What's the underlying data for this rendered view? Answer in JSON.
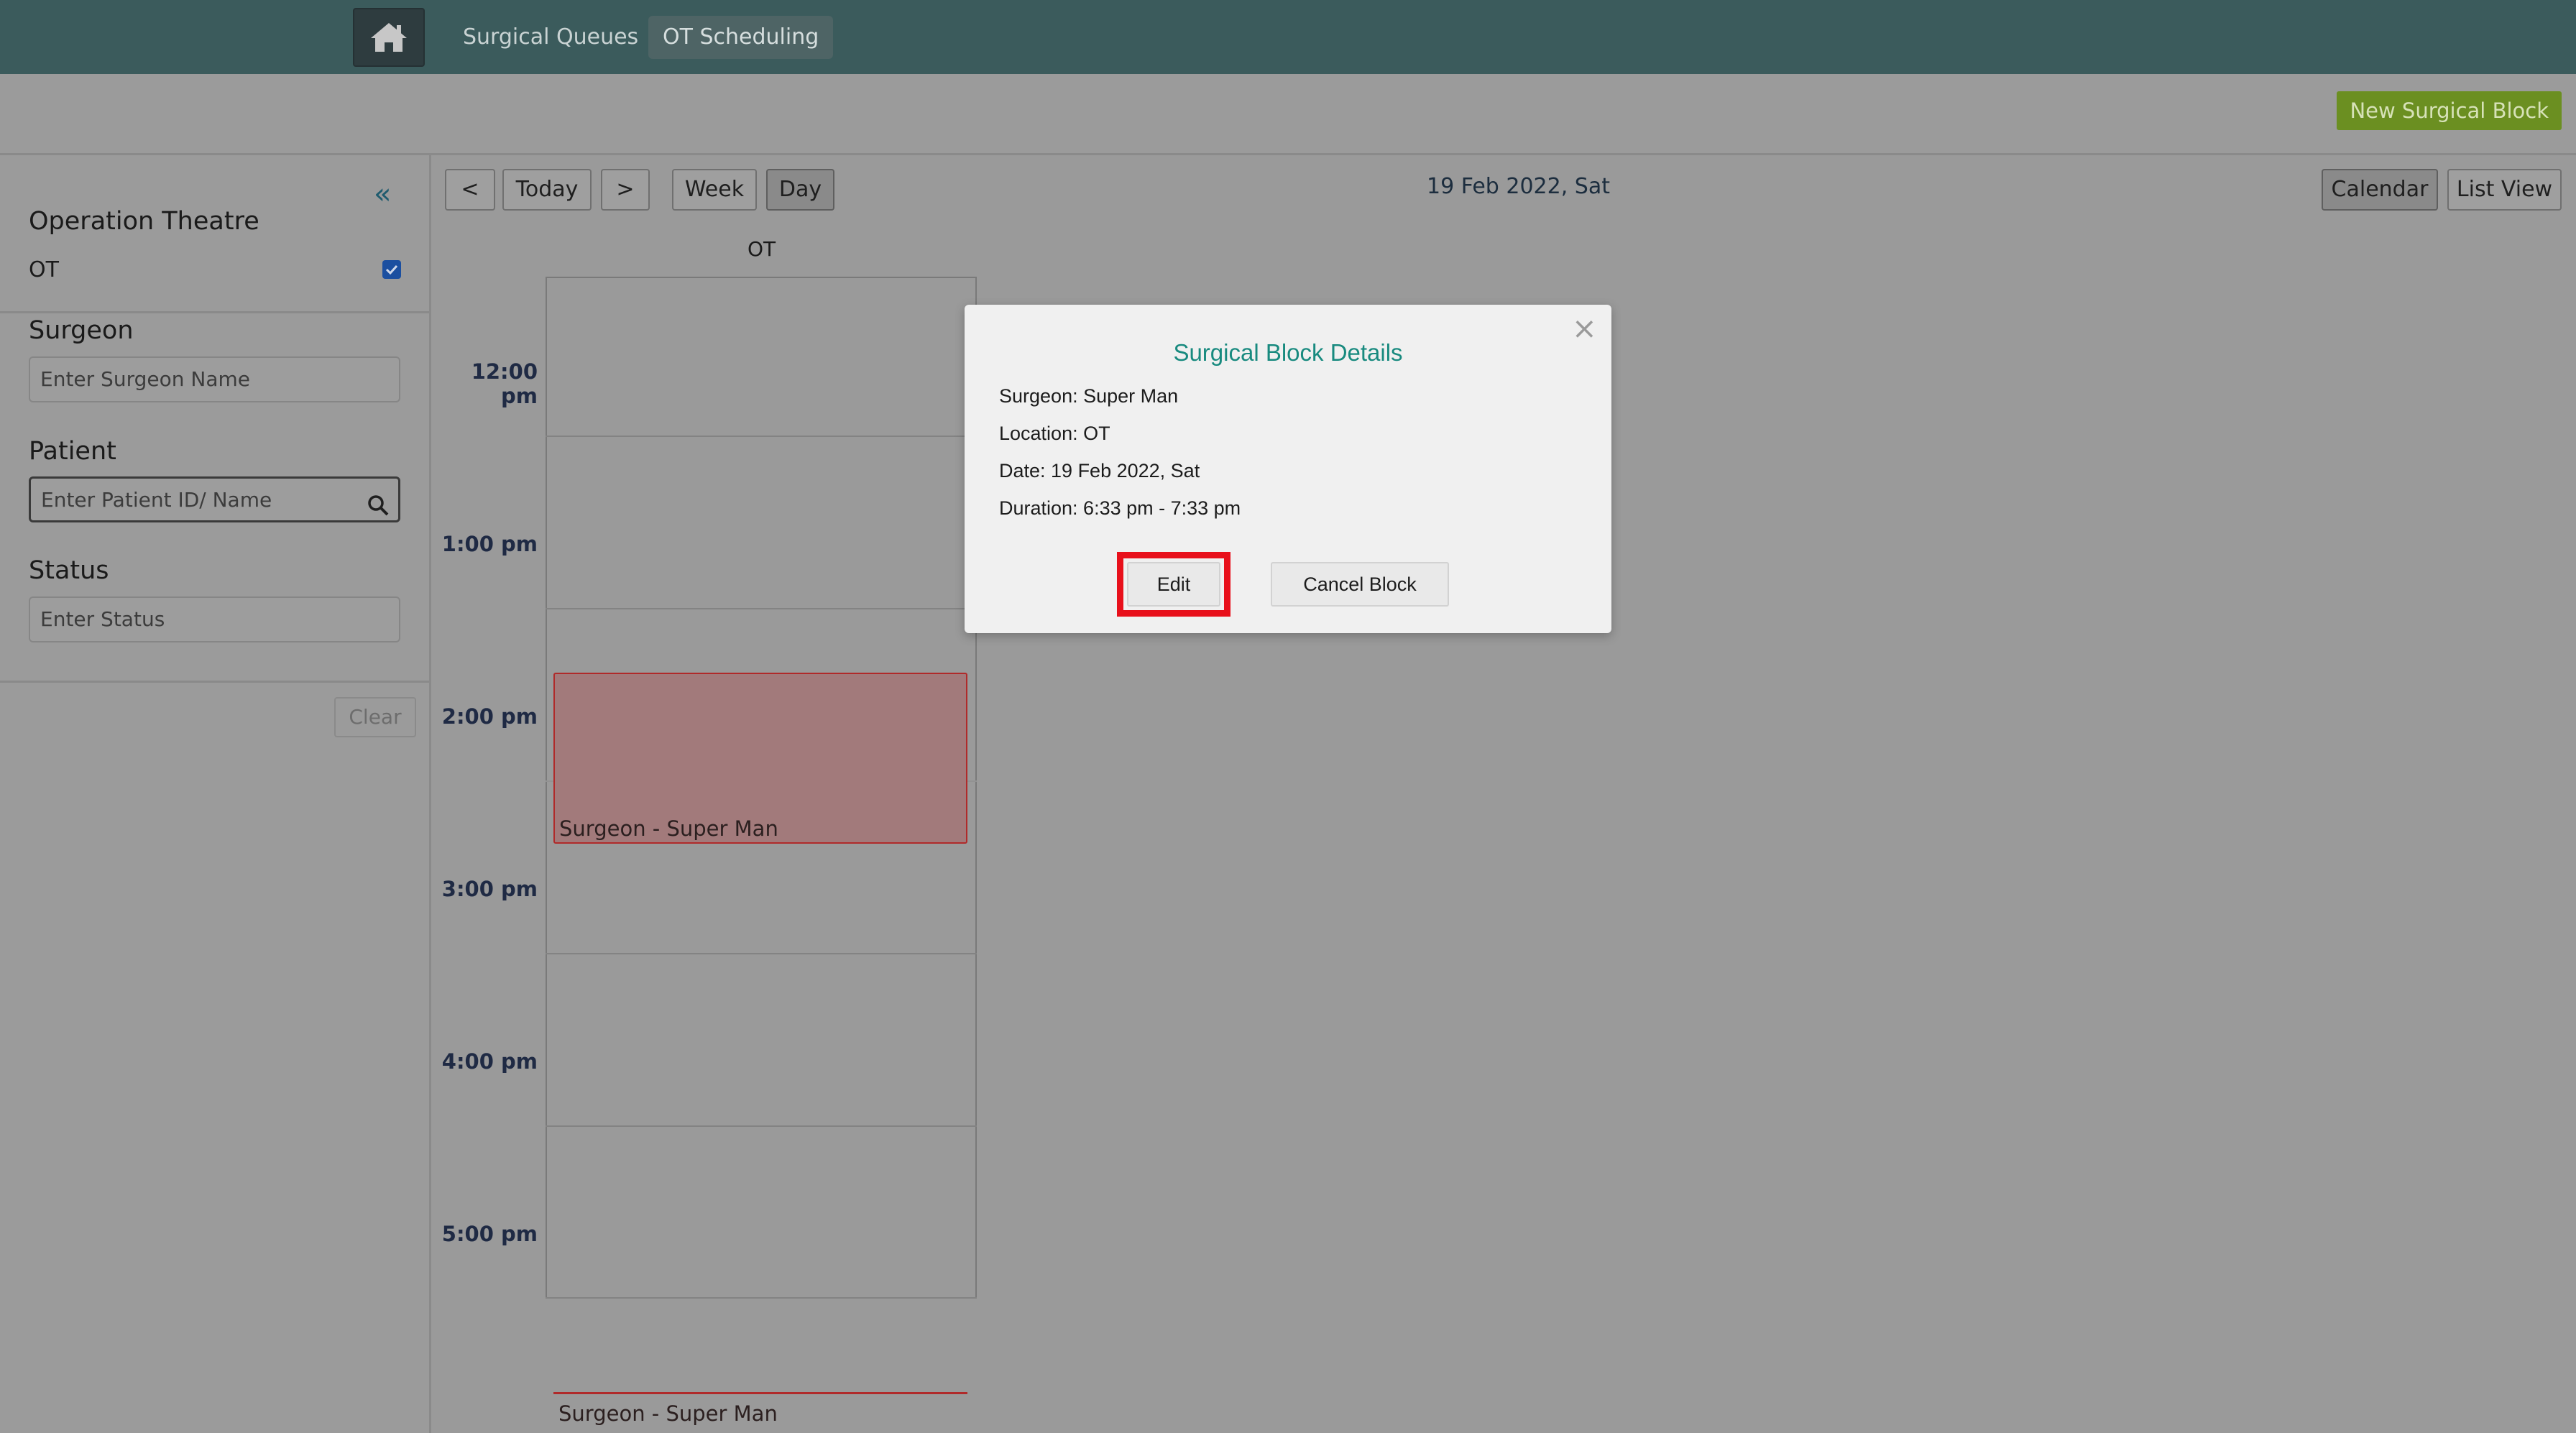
{
  "nav": {
    "home_icon": "home-icon",
    "links": [
      {
        "label": "Surgical Queues"
      },
      {
        "label": "OT Scheduling",
        "active": true
      }
    ]
  },
  "actionbar": {
    "new_block_label": "New Surgical Block"
  },
  "sidebar": {
    "collapse_icon": "double-chevron-left-icon",
    "ot_heading": "Operation Theatre",
    "ot_item": "OT",
    "ot_checked": true,
    "surgeon_heading": "Surgeon",
    "surgeon_placeholder": "Enter Surgeon Name",
    "patient_heading": "Patient",
    "patient_placeholder": "Enter Patient ID/ Name",
    "status_heading": "Status",
    "status_placeholder": "Enter Status",
    "clear_label": "Clear"
  },
  "calendar": {
    "prev_label": "<",
    "today_label": "Today",
    "next_label": ">",
    "week_label": "Week",
    "day_label": "Day",
    "date": "19 Feb 2022, Sat",
    "calendar_label": "Calendar",
    "list_view_label": "List View",
    "column": "OT",
    "times": [
      "12:00 pm",
      "1:00 pm",
      "2:00 pm",
      "3:00 pm",
      "4:00 pm",
      "5:00 pm"
    ],
    "events": [
      {
        "label": "Surgeon - Super Man"
      },
      {
        "label": "Surgeon - Super Man"
      }
    ]
  },
  "modal": {
    "title": "Surgical Block Details",
    "surgeon": "Surgeon: Super Man",
    "location": "Location: OT",
    "date": "Date: 19 Feb 2022, Sat",
    "duration": "Duration: 6:33 pm - 7:33 pm",
    "edit_label": "Edit",
    "cancel_label": "Cancel Block",
    "close_icon": "close-icon"
  }
}
